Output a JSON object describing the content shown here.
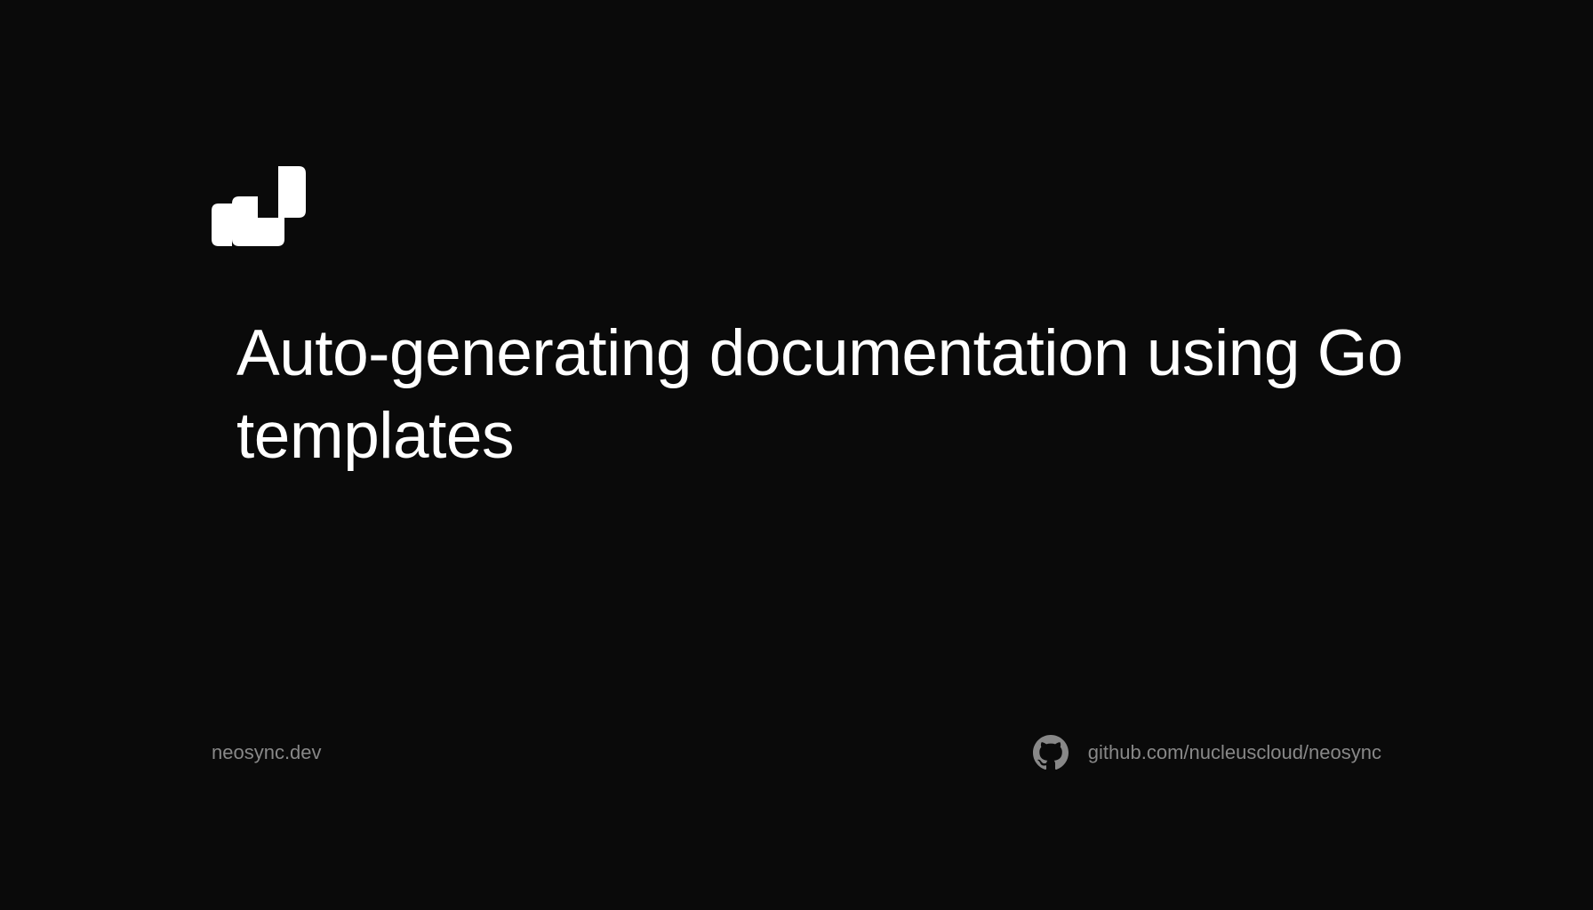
{
  "title": "Auto-generating documentation using Go templates",
  "footer": {
    "domain": "neosync.dev",
    "github_url": "github.com/nucleuscloud/neosync"
  }
}
